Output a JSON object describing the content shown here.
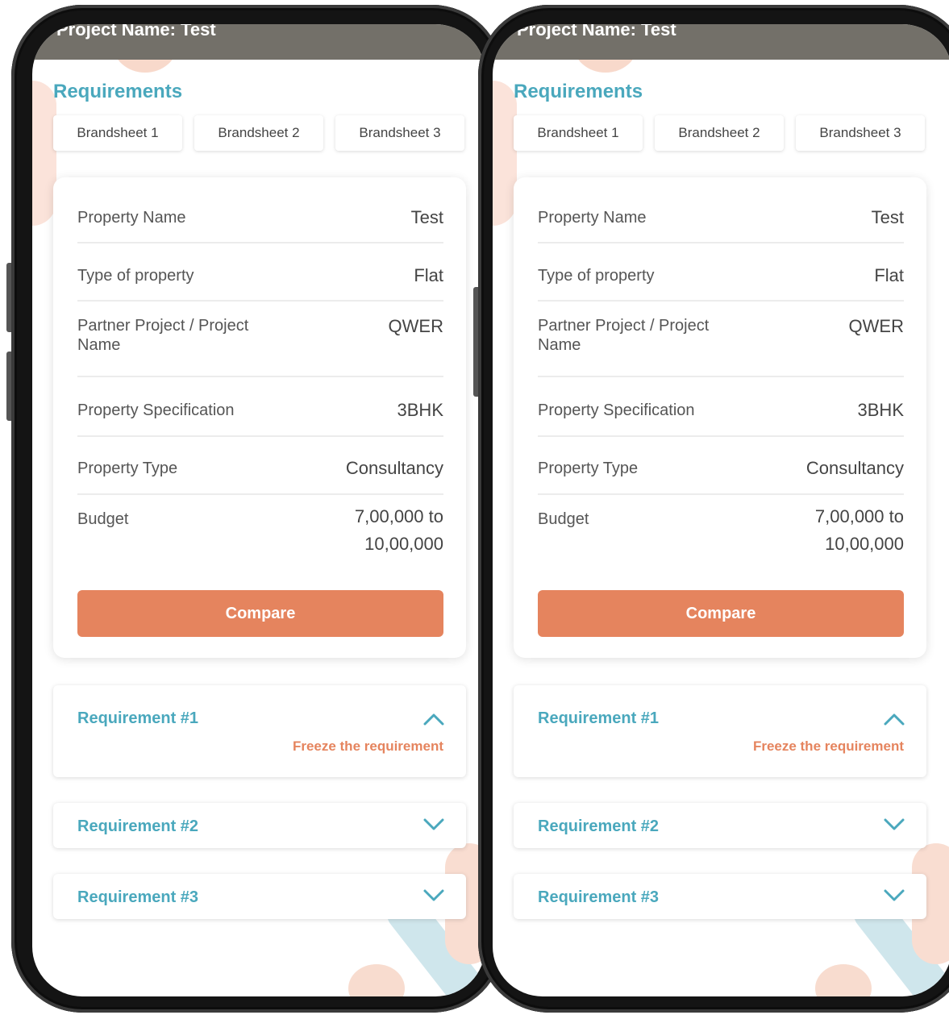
{
  "header": {
    "title": "Project Name: Test"
  },
  "requirements_heading": "Requirements",
  "tabs": [
    {
      "label": "Brandsheet 1"
    },
    {
      "label": "Brandsheet 2"
    },
    {
      "label": "Brandsheet 3"
    }
  ],
  "details": [
    {
      "label": "Property Name",
      "value": "Test"
    },
    {
      "label": "Type of property",
      "value": "Flat"
    },
    {
      "label": "Partner Project / Project Name",
      "value": "QWER"
    },
    {
      "label": "Property Specification",
      "value": "3BHK"
    },
    {
      "label": "Property Type",
      "value": "Consultancy"
    },
    {
      "label": "Budget",
      "value": "7,00,000 to 10,00,000"
    }
  ],
  "compare_label": "Compare",
  "accordions": [
    {
      "title": "Requirement #1",
      "expanded": true,
      "action": "Freeze the requirement"
    },
    {
      "title": "Requirement #2",
      "expanded": false
    },
    {
      "title": "Requirement #3",
      "expanded": false
    }
  ],
  "colors": {
    "accent": "#4aa8bd",
    "button": "#e5845e",
    "topbar": "#737069"
  }
}
